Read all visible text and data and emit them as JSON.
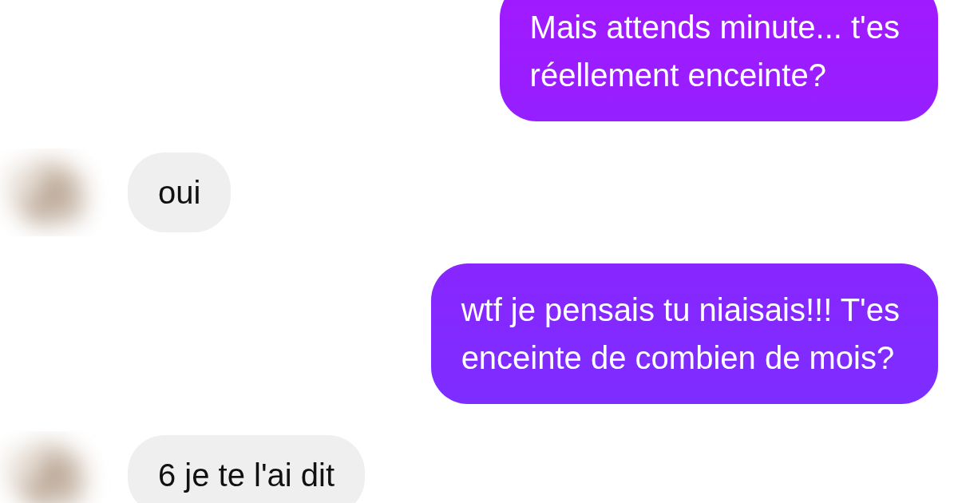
{
  "messages": [
    {
      "kind": "sent",
      "text": "Mais attends minute... t'es\nréellement enceinte?"
    },
    {
      "kind": "received",
      "text": "oui"
    },
    {
      "kind": "sent",
      "text": "wtf je pensais tu niaisais!!! T'es\nenceinte de combien de mois?"
    },
    {
      "kind": "received",
      "text": "6 je te l'ai dit"
    }
  ]
}
